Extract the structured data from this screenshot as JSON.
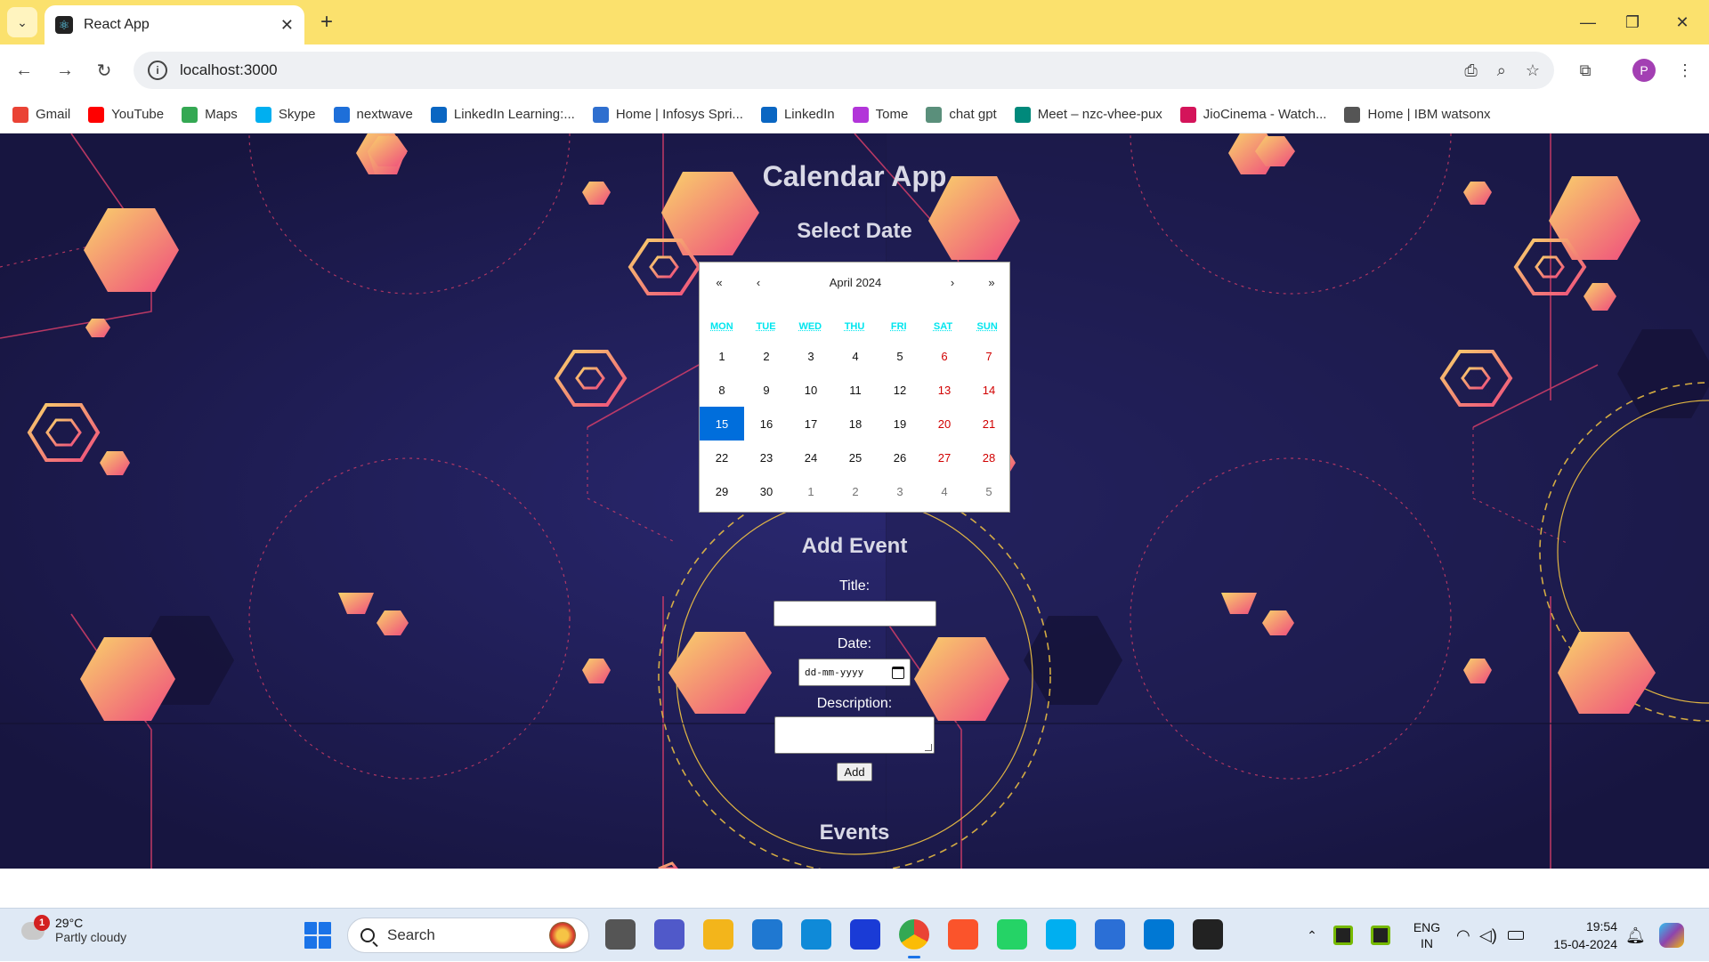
{
  "browser": {
    "tab_title": "React App",
    "url": "localhost:3000",
    "profile_initial": "P"
  },
  "bookmarks": [
    {
      "label": "Gmail",
      "icon": "gmail-icon",
      "color": "#ea4335"
    },
    {
      "label": "YouTube",
      "icon": "youtube-icon",
      "color": "#ff0000"
    },
    {
      "label": "Maps",
      "icon": "maps-icon",
      "color": "#34a853"
    },
    {
      "label": "Skype",
      "icon": "skype-icon",
      "color": "#00aff0"
    },
    {
      "label": "nextwave",
      "icon": "nextwave-icon",
      "color": "#1e6fd9"
    },
    {
      "label": "LinkedIn Learning:...",
      "icon": "linkedin-learning-icon",
      "color": "#0a66c2"
    },
    {
      "label": "Home | Infosys Spri...",
      "icon": "infosys-icon",
      "color": "#2f6fcf"
    },
    {
      "label": "LinkedIn",
      "icon": "linkedin-icon",
      "color": "#0a66c2"
    },
    {
      "label": "Tome",
      "icon": "tome-icon",
      "color": "#b235d9"
    },
    {
      "label": "chat gpt",
      "icon": "chatgpt-icon",
      "color": "#5a8f7b"
    },
    {
      "label": "Meet – nzc-vhee-pux",
      "icon": "meet-icon",
      "color": "#00897b"
    },
    {
      "label": "JioCinema - Watch...",
      "icon": "jiocinema-icon",
      "color": "#d4145a"
    },
    {
      "label": "Home | IBM watsonx",
      "icon": "ibm-watsonx-icon",
      "color": "#555555"
    }
  ],
  "page": {
    "title": "Calendar App",
    "select_heading": "Select Date",
    "add_heading": "Add Event",
    "events_heading": "Events",
    "form": {
      "title_label": "Title:",
      "title_value": "",
      "date_label": "Date:",
      "date_placeholder": "dd-mm-yyyy",
      "description_label": "Description:",
      "description_value": "",
      "add_label": "Add"
    }
  },
  "calendar": {
    "month_label": "April 2024",
    "nav": {
      "prev2": "«",
      "prev": "‹",
      "next": "›",
      "next2": "»"
    },
    "weekdays": [
      "MON",
      "TUE",
      "WED",
      "THU",
      "FRI",
      "SAT",
      "SUN"
    ],
    "days": [
      {
        "n": "1",
        "t": "d"
      },
      {
        "n": "2",
        "t": "d"
      },
      {
        "n": "3",
        "t": "d"
      },
      {
        "n": "4",
        "t": "d"
      },
      {
        "n": "5",
        "t": "d"
      },
      {
        "n": "6",
        "t": "w"
      },
      {
        "n": "7",
        "t": "w"
      },
      {
        "n": "8",
        "t": "d"
      },
      {
        "n": "9",
        "t": "d"
      },
      {
        "n": "10",
        "t": "d"
      },
      {
        "n": "11",
        "t": "d"
      },
      {
        "n": "12",
        "t": "d"
      },
      {
        "n": "13",
        "t": "w"
      },
      {
        "n": "14",
        "t": "w"
      },
      {
        "n": "15",
        "t": "a"
      },
      {
        "n": "16",
        "t": "d"
      },
      {
        "n": "17",
        "t": "d"
      },
      {
        "n": "18",
        "t": "d"
      },
      {
        "n": "19",
        "t": "d"
      },
      {
        "n": "20",
        "t": "w"
      },
      {
        "n": "21",
        "t": "w"
      },
      {
        "n": "22",
        "t": "d"
      },
      {
        "n": "23",
        "t": "d"
      },
      {
        "n": "24",
        "t": "d"
      },
      {
        "n": "25",
        "t": "d"
      },
      {
        "n": "26",
        "t": "d"
      },
      {
        "n": "27",
        "t": "w"
      },
      {
        "n": "28",
        "t": "w"
      },
      {
        "n": "29",
        "t": "d"
      },
      {
        "n": "30",
        "t": "d"
      },
      {
        "n": "1",
        "t": "o"
      },
      {
        "n": "2",
        "t": "o"
      },
      {
        "n": "3",
        "t": "o"
      },
      {
        "n": "4",
        "t": "o"
      },
      {
        "n": "5",
        "t": "o"
      }
    ],
    "selected_day": "15",
    "colors": {
      "weekday_header": "#00e5ee",
      "weekend": "#d10000",
      "selected": "#006edc"
    }
  },
  "taskbar": {
    "weather_temp": "29°C",
    "weather_desc": "Partly cloudy",
    "weather_badge": "1",
    "search_placeholder": "Search",
    "lang_1": "ENG",
    "lang_2": "IN",
    "time": "19:54",
    "date": "15-04-2024",
    "apps": [
      {
        "name": "file-explorer-icon"
      },
      {
        "name": "teams-icon"
      },
      {
        "name": "folder-icon"
      },
      {
        "name": "store-icon"
      },
      {
        "name": "edge-icon"
      },
      {
        "name": "l-app-icon"
      },
      {
        "name": "chrome-icon"
      },
      {
        "name": "brave-icon"
      },
      {
        "name": "whatsapp-icon"
      },
      {
        "name": "skype-icon"
      },
      {
        "name": "notepad-icon"
      },
      {
        "name": "vscode-icon"
      },
      {
        "name": "media-player-icon"
      }
    ]
  }
}
